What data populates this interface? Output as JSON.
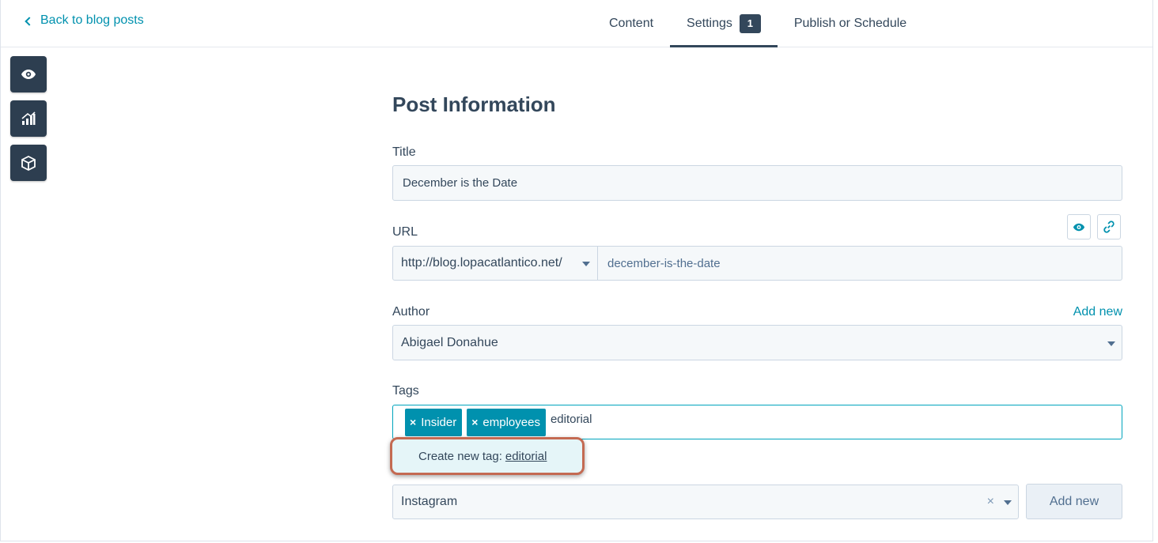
{
  "header": {
    "back_label": "Back to blog posts",
    "tabs": [
      {
        "label": "Content"
      },
      {
        "label": "Settings",
        "badge": "1"
      },
      {
        "label": "Publish or Schedule"
      }
    ]
  },
  "toolbar": {
    "icons": [
      "eye-icon",
      "chart-icon",
      "box-icon"
    ]
  },
  "form": {
    "section_title": "Post Information",
    "title_label": "Title",
    "title_value": "December is the Date",
    "url_label": "URL",
    "url_domain": "http://blog.lopacatlantico.net/",
    "url_slug": "december-is-the-date",
    "author_label": "Author",
    "author_add_new": "Add new",
    "author_value": "Abigael Donahue",
    "tags_label": "Tags",
    "tags": [
      "Insider",
      "employees"
    ],
    "tag_remove_symbol": "×",
    "tag_input_value": "editorial",
    "create_tag_prefix": "Create new tag:",
    "create_tag_value": "editorial",
    "campaign_value": "Instagram",
    "campaign_clear": "×",
    "campaign_add_new": "Add new"
  },
  "colors": {
    "accent": "#0091ae",
    "dark": "#33475b",
    "highlight_border": "#c46a52"
  }
}
